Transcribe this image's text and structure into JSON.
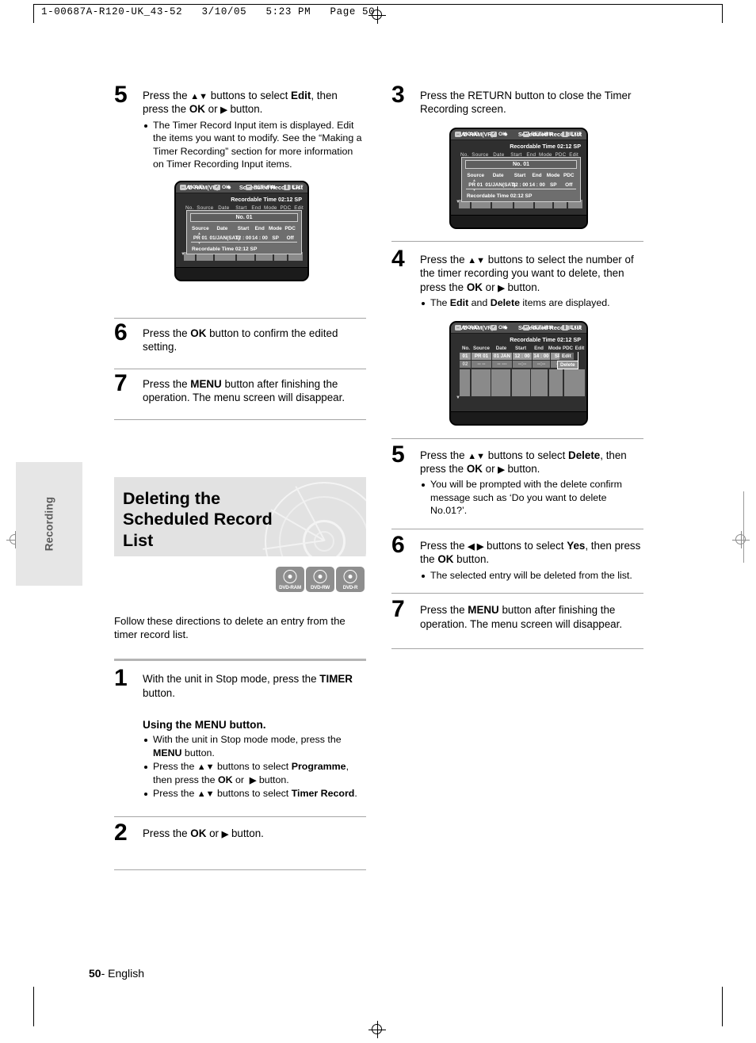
{
  "print_header": {
    "text": "1-00687A-R120-UK_43-52   3/10/05   5:23 PM   Page 50"
  },
  "side_tab": {
    "label": "Recording"
  },
  "footer": {
    "page": "50",
    "lang": "- English"
  },
  "left_column": {
    "step5": {
      "num": "5",
      "text_parts": [
        "Press the ",
        "▲▼",
        " buttons to select ",
        "Edit",
        ", then press the ",
        "OK",
        " or ",
        "▶",
        " button."
      ],
      "bullets": [
        "The Timer Record Input item is displayed. Edit the items you want to modify. See the “Making a Timer Recording” section for more information on Timer Recording Input items."
      ]
    },
    "step6": {
      "num": "6",
      "text": "Press the OK button to confirm the edited setting.",
      "bold_words": [
        "OK"
      ]
    },
    "step7": {
      "num": "7",
      "text": "Press the MENU button after finishing the operation. The menu screen will disappear.",
      "bold_words": [
        "MENU"
      ]
    },
    "section": {
      "title": "Deleting the Scheduled Record List",
      "badges": [
        "DVD-RAM",
        "DVD-RW",
        "DVD-R"
      ],
      "intro": "Follow these directions to delete an entry from the timer record list."
    },
    "step1": {
      "num": "1",
      "text": "With the unit in Stop mode, press the TIMER button.",
      "bold_words": [
        "TIMER"
      ]
    },
    "menu_subsection": {
      "heading": "Using the MENU button.",
      "bullets": [
        "With the unit in Stop mode mode, press the MENU button.",
        "Press the ▲▼ buttons to select Programme, then press the OK or ▶ button.",
        "Press the ▲▼ buttons to select Timer Record."
      ]
    },
    "step2": {
      "num": "2",
      "text": "Press the OK or ▶ button.",
      "bold_words": [
        "OK"
      ]
    }
  },
  "right_column": {
    "step3": {
      "num": "3",
      "text": "Press the RETURN button to close the Timer Recording screen."
    },
    "step4": {
      "num": "4",
      "text": "Press the ▲▼ buttons to select the number of the timer recording you want to delete, then press the OK or ▶ button.",
      "bullets": [
        "The Edit and Delete items are displayed."
      ]
    },
    "step5": {
      "num": "5",
      "text": "Press the ▲▼ buttons to select Delete, then press the OK or ▶ button.",
      "bullets": [
        "You will be prompted with the delete confirm message such as ‘Do you want to delete No.01?’."
      ]
    },
    "step6": {
      "num": "6",
      "text": "Press the ◀ ▶ buttons to select Yes, then press the OK button.",
      "bullets": [
        "The selected entry will be deleted from the list."
      ]
    },
    "step7": {
      "num": "7",
      "text": "Press the MENU button after finishing the operation. The menu screen will disappear."
    }
  },
  "osd_screens": {
    "input_dialog": {
      "disc_label": "DVD-RAM(VR)",
      "screen_title": "Scheduled Record List",
      "recordable_time": "Recordable Time 02:12 SP",
      "bg_columns": [
        "No.",
        "Source",
        "Date",
        "Start",
        "End",
        "Mode",
        "PDC",
        "Edit"
      ],
      "dialog_no": "No. 01",
      "dialog_headers": [
        "Source",
        "Date",
        "Start",
        "End",
        "Mode",
        "PDC"
      ],
      "dialog_values": [
        "PR 01",
        "01/JAN(SAT)",
        "12 : 00",
        "14 : 00",
        "SP",
        "Off"
      ],
      "dialog_footer": "Recordable Time 02:12 SP",
      "keys": [
        "MOVE",
        "OK",
        "RETURN",
        "EXIT"
      ],
      "key_glyphs": [
        "↔",
        "✓",
        "↩",
        "❙"
      ]
    },
    "list_screen": {
      "disc_label": "DVD-RAM(VR)",
      "screen_title": "Scheduled Record List",
      "recordable_time": "Recordable Time 02:12 SP",
      "columns": [
        "No.",
        "Source",
        "Date",
        "Start",
        "End",
        "Mode",
        "PDC",
        "Edit"
      ],
      "rows": [
        {
          "no": "01",
          "source": "PR 01",
          "date": "01 JAN",
          "start": "12 : 00",
          "end": "14 : 00",
          "mode": "SP",
          "pdc": "",
          "edit": "Edit"
        },
        {
          "no": "02",
          "source": "-- --",
          "date": "-- ---",
          "start": "--:--",
          "end": "--:--",
          "mode": "--",
          "pdc": "",
          "edit": "Delete"
        }
      ],
      "popup_items": [
        "Edit",
        "Delete"
      ],
      "keys": [
        "MOVE",
        "OK",
        "RETURN",
        "EXIT"
      ],
      "key_glyphs": [
        "↔",
        "✓",
        "↩",
        "❙"
      ]
    }
  }
}
